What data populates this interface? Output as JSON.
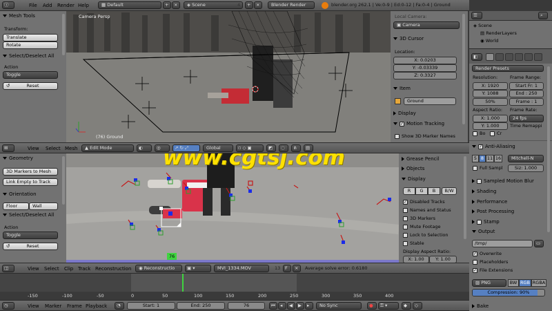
{
  "top_bar": {
    "menus": [
      "File",
      "Add",
      "Render",
      "Help"
    ],
    "layout": "Default",
    "scene": "Scene",
    "scene_count": "4",
    "engine": "Blender Render",
    "stats": "blender.org 262.1 | Ve:0-9 | Ed:0-12 | Fa:0-4 | Ground"
  },
  "left_tools_top": {
    "title": "Mesh Tools",
    "transform_label": "Transform:",
    "translate": "Translate",
    "rotate": "Rotate",
    "select_title": "Select/Deselect All",
    "action_label": "Action",
    "action_value": "Toggle",
    "reset": "Reset"
  },
  "viewport_3d": {
    "label": "Camera Persp",
    "object_label": "(76) Ground",
    "header_menus": [
      "View",
      "Select",
      "Mesh"
    ],
    "mode": "Edit Mode",
    "orientation": "Global"
  },
  "right_props_3d": {
    "local_camera_label": "Local Camera:",
    "camera": "Camera",
    "cursor_title": "3D Cursor",
    "location_label": "Location:",
    "x": "X: 0.0203",
    "y": "Y: -0.03339",
    "z": "Z: 0.3327",
    "item_title": "Item",
    "item_name": "Ground",
    "display_title": "Display",
    "motion_tracking": "Motion Tracking",
    "show_markers": "Show 3D Marker Names"
  },
  "outliner": {
    "scene": "Scene",
    "render_layers": "RenderLayers",
    "world": "World"
  },
  "render_props": {
    "presets": "Render Presets",
    "resolution_label": "Resolution:",
    "res_x": "X: 1920",
    "res_y": "Y: 1088",
    "res_pct": "50%",
    "frame_range_label": "Frame Range:",
    "start_fr": "Start Fr: 1",
    "end": "End : 250",
    "frame": "Frame : 1",
    "aspect_label": "Aspect Ratio:",
    "aspect_x": "X: 1.000",
    "aspect_y": "Y: 1.000",
    "frame_rate_label": "Frame Rate:",
    "fps": "24 fps",
    "time_remap": "Time Remappi",
    "bo_label": "Bo",
    "cr_label": "Cr",
    "aa_title": "Anti-Aliasing",
    "aa_samples": [
      "5",
      "8",
      "11",
      "16"
    ],
    "aa_filter": "Mitchell-N",
    "full_sample": "Full Sampl",
    "size": "Siz: 1.000",
    "sampled_motion": "Sampled Motion Blur",
    "shading": "Shading",
    "performance": "Performance",
    "post_processing": "Post Processing",
    "stamp": "Stamp",
    "output_title": "Output",
    "output_path": "/tmp/",
    "overwrite": "Overwrite",
    "placeholders": "Placeholders",
    "file_extensions": "File Extensions",
    "format": "PNG",
    "color_modes": [
      "BW",
      "RGB",
      "RGBA"
    ],
    "compression": "Compression: 90%",
    "bake": "Bake"
  },
  "left_tools_clip": {
    "geometry_title": "Geometry",
    "markers_to_mesh": "3D Markers to Mesh",
    "link_empty": "Link Empty to Track",
    "orientation_title": "Orientation",
    "floor": "Floor",
    "wall": "Wall",
    "select_title": "Select/Deselect All",
    "action_label": "Action",
    "action_value": "Toggle",
    "reset": "Reset"
  },
  "clip_props": {
    "grease_pencil": "Grease Pencil",
    "objects": "Objects",
    "display_title": "Display",
    "channels": [
      "R",
      "G",
      "B",
      "B/W"
    ],
    "options": [
      "Disabled Tracks",
      "Names and Status",
      "3D Markers",
      "Mute Footage",
      "Lock to Selection",
      "Stable"
    ],
    "aspect_label": "Display Aspect Ratio:",
    "aspect_x": "X: 1.00",
    "aspect_y": "Y: 1.00"
  },
  "clip_editor": {
    "frame_badge": "76",
    "header_menus": [
      "View",
      "Select",
      "Clip",
      "Track",
      "Reconstruction"
    ],
    "mode": "Reconstructio",
    "clip_name": "MVI_1334.MOV",
    "users": "13",
    "solve_error": "Average solve error: 0.6180"
  },
  "watermark": "www.cgtsj.com",
  "timeline": {
    "ticks": [
      "-150",
      "-100",
      "-50",
      "0",
      "50",
      "100",
      "150",
      "200",
      "250",
      "300",
      "350",
      "400"
    ],
    "menus": [
      "View",
      "Marker",
      "Frame",
      "Playback"
    ],
    "start": "Start: 1",
    "end": "End: 250",
    "current": "76",
    "sync": "No Sync"
  }
}
